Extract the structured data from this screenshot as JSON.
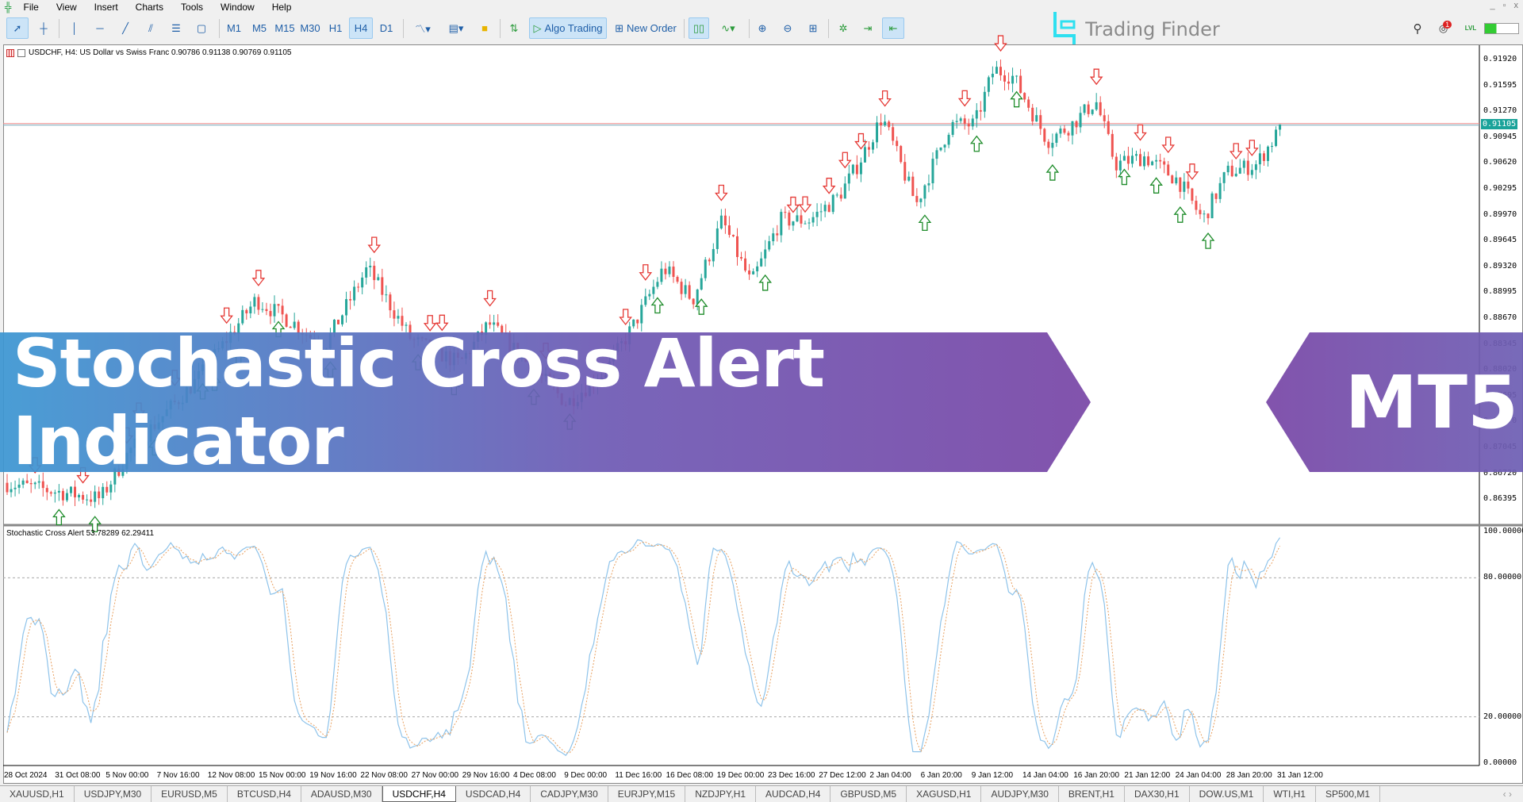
{
  "menu": [
    "File",
    "View",
    "Insert",
    "Charts",
    "Tools",
    "Window",
    "Help"
  ],
  "window_controls": [
    "_",
    "▫",
    "x"
  ],
  "toolbar": {
    "timeframes": [
      "M1",
      "M5",
      "M15",
      "M30",
      "H1",
      "H4",
      "D1"
    ],
    "active_timeframe": "H4",
    "algo_trading": "Algo Trading",
    "new_order": "New Order",
    "notification_count": "1",
    "lvl": "LVL"
  },
  "logo": {
    "text": "Trading Finder"
  },
  "chart": {
    "header": "USDCHF, H4:  US Dollar vs Swiss Franc  0.90786 0.91138 0.90769 0.91105",
    "price_ticks": [
      "0.91920",
      "0.91595",
      "0.91270",
      "0.90945",
      "0.90620",
      "0.90295",
      "0.89970",
      "0.89645",
      "0.89320",
      "0.88995",
      "0.88670",
      "0.88345",
      "0.88020",
      "0.87695",
      "0.87370",
      "0.87045",
      "0.86720",
      "0.86395"
    ],
    "current_price": "0.91105",
    "colors": {
      "bull": "#26a69a",
      "bear": "#ef5350",
      "up_arrow": "#1e8c2a",
      "down_arrow": "#e53935",
      "price_line": "#e88",
      "bid_line": "#7ab"
    }
  },
  "indicator": {
    "label": "Stochastic Cross Alert 53.78289 62.29411",
    "levels": [
      "100.00000",
      "80.00000",
      "20.00000",
      "0.00000"
    ],
    "colors": {
      "main": "#8ec3ea",
      "signal": "#e8a060"
    }
  },
  "time_axis": [
    "28 Oct 2024",
    "31 Oct 08:00",
    "5 Nov 00:00",
    "7 Nov 16:00",
    "12 Nov 08:00",
    "15 Nov 00:00",
    "19 Nov 16:00",
    "22 Nov 08:00",
    "27 Nov 00:00",
    "29 Nov 16:00",
    "4 Dec 08:00",
    "9 Dec 00:00",
    "11 Dec 16:00",
    "16 Dec 08:00",
    "19 Dec 00:00",
    "23 Dec 16:00",
    "27 Dec 12:00",
    "2 Jan 04:00",
    "6 Jan 20:00",
    "9 Jan 12:00",
    "14 Jan 04:00",
    "16 Jan 20:00",
    "21 Jan 12:00",
    "24 Jan 04:00",
    "28 Jan 20:00",
    "31 Jan 12:00"
  ],
  "tabs": [
    "XAUUSD,H1",
    "USDJPY,M30",
    "EURUSD,M5",
    "BTCUSD,H4",
    "ADAUSD,M30",
    "USDCHF,H4",
    "USDCAD,H4",
    "CADJPY,M30",
    "EURJPY,M15",
    "NZDJPY,H1",
    "AUDCAD,H4",
    "GBPUSD,M5",
    "XAGUSD,H1",
    "AUDJPY,M30",
    "BRENT,H1",
    "DAX30,H1",
    "DOW.US,M1",
    "WTI,H1",
    "SP500,M1"
  ],
  "active_tab": "USDCHF,H4",
  "banner": {
    "title": "Stochastic Cross Alert Indicator",
    "badge": "MT5"
  }
}
